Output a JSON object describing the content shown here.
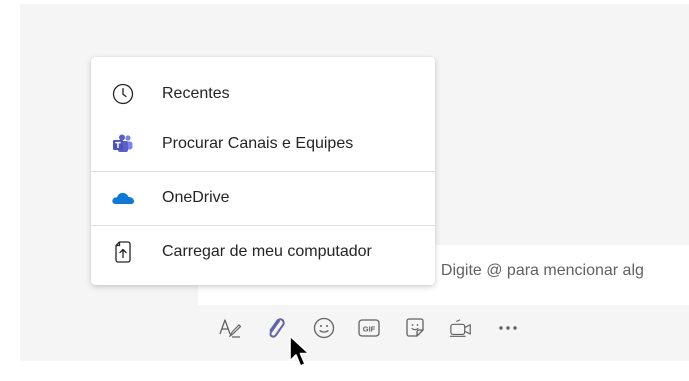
{
  "compose": {
    "placeholder_visible": ". Digite @ para mencionar alg"
  },
  "attach_menu": {
    "items": [
      {
        "label": "Recentes",
        "icon": "clock-icon"
      },
      {
        "label": "Procurar Canais e Equipes",
        "icon": "teams-icon"
      },
      {
        "label": "OneDrive",
        "icon": "onedrive-icon"
      },
      {
        "label": "Carregar de meu computador",
        "icon": "upload-file-icon"
      }
    ]
  },
  "toolbar": {
    "icons": [
      "format-icon",
      "attach-icon",
      "emoji-icon",
      "gif-icon",
      "sticker-icon",
      "meet-now-icon",
      "more-icon"
    ],
    "gif_label": "GIF"
  },
  "colors": {
    "accent": "#6264a7",
    "onedrive": "#0f78d4",
    "teams": "#5b5fc7"
  }
}
